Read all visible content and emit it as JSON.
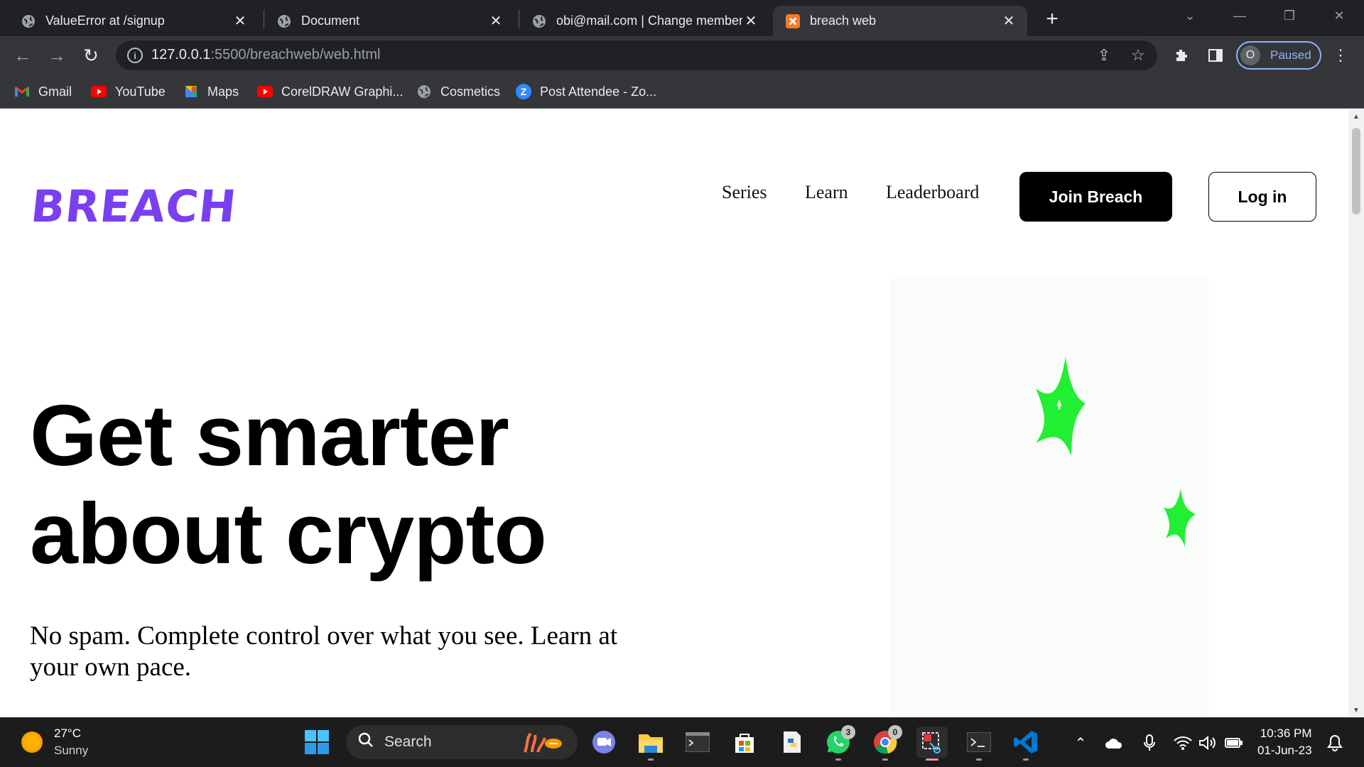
{
  "browser": {
    "tabs": [
      {
        "title": "ValueError at /signup",
        "favicon": "globe-icon",
        "active": false
      },
      {
        "title": "Document",
        "favicon": "globe-icon",
        "active": false
      },
      {
        "title": "obi@mail.com | Change member",
        "favicon": "globe-icon",
        "active": false
      },
      {
        "title": "breach web",
        "favicon": "xampp-icon",
        "active": true
      }
    ],
    "url_host": "127.0.0.1",
    "url_rest": ":5500/breachweb/web.html",
    "profile_initial": "O",
    "profile_status": "Paused",
    "bookmarks": [
      {
        "label": "Gmail",
        "icon": "gmail-icon"
      },
      {
        "label": "YouTube",
        "icon": "youtube-icon"
      },
      {
        "label": "Maps",
        "icon": "maps-icon"
      },
      {
        "label": "CorelDRAW Graphi...",
        "icon": "youtube-icon"
      },
      {
        "label": "Cosmetics",
        "icon": "globe-icon"
      },
      {
        "label": "Post Attendee - Zo...",
        "icon": "zoom-icon"
      }
    ]
  },
  "page": {
    "logo": "BREACH",
    "nav": [
      "Series",
      "Learn",
      "Leaderboard"
    ],
    "join_label": "Join Breach",
    "login_label": "Log in",
    "hero_line1": "Get smarter",
    "hero_line2": "about crypto",
    "hero_sub": "No spam. Complete control over what you see. Learn at your own pace.",
    "brand_color": "#7b3ff2",
    "star_color": "#22ee33"
  },
  "taskbar": {
    "temperature": "27°C",
    "weather": "Sunny",
    "search_label": "Search",
    "whatsapp_badge": "3",
    "chrome_badge": "0",
    "time": "10:36 PM",
    "date": "01-Jun-23"
  }
}
